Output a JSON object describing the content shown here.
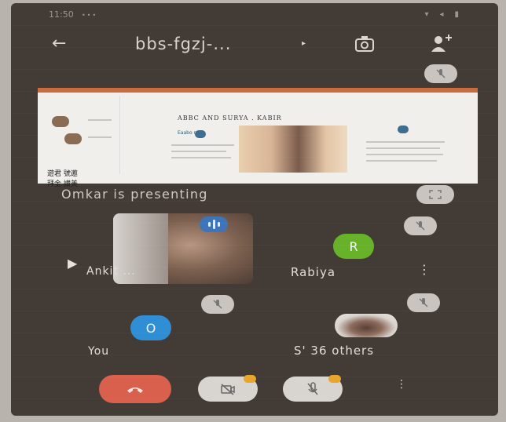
{
  "status_bar": {
    "time": "11:50",
    "indicators": "•••"
  },
  "header": {
    "back_icon": "back-arrow-icon",
    "title": "bbs-fgzj-...",
    "title_caret": "▸"
  },
  "slide": {
    "heading": "ABBC AND SURYA . KABIR",
    "subtext": "Eaabo ngb",
    "left_caption": "遊君 號邀\n拜金 讃美"
  },
  "presenting": {
    "text": "Omkar is presenting"
  },
  "participants": {
    "video_tile_name": "Ankit ...",
    "rabiya": {
      "initial": "R",
      "name": "Rabiya",
      "color": "#68b22a"
    },
    "you": {
      "initial": "O",
      "name": "You",
      "color": "#2f8ed4"
    },
    "others": {
      "label": "S' 36 others"
    }
  },
  "controls": {
    "end_call_color": "#d9604d",
    "more_icon": "⋮"
  },
  "colors": {
    "background": "#433b36",
    "accent_blue": "#3e75b8",
    "warning": "#e8a52a"
  }
}
